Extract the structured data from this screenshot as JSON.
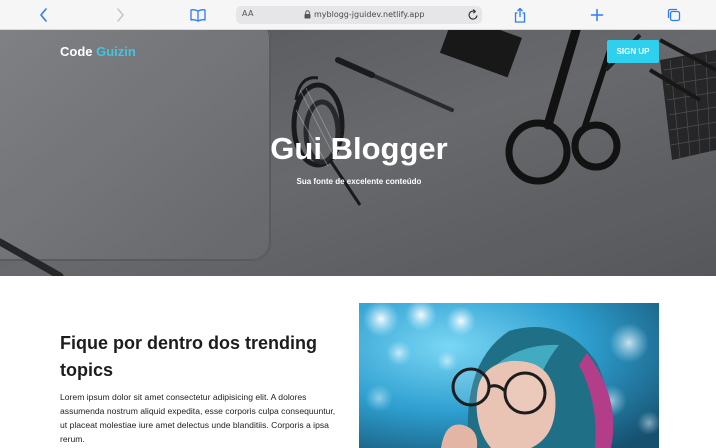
{
  "browser": {
    "address_aa": "AA",
    "url": "myblogg-jguidev.netlify.app",
    "icons": [
      "back-icon",
      "forward-icon",
      "bookmarks-icon",
      "lock-icon",
      "reload-icon",
      "share-icon",
      "new-tab-icon",
      "tabs-icon"
    ]
  },
  "header": {
    "brand_primary": "Code",
    "brand_accent": "Guizin",
    "signup_label": "SIGN UP"
  },
  "hero": {
    "title": "Gui Blogger",
    "subtitle": "Sua fonte de excelente conteúdo"
  },
  "section": {
    "heading": "Fique por dentro dos trending topics",
    "paragraph": "Lorem ipsum dolor sit amet consectetur adipisicing elit. A dolores assumenda nostrum aliquid expedita, esse corporis culpa consequuntur, ut placeat molestiae iure amet delectus unde blanditiis. Corporis a ipsa rerum."
  },
  "colors": {
    "accent": "#2fd0ee",
    "brand_accent": "#3ec6e4",
    "toolbar_icon": "#2f7cf6"
  }
}
